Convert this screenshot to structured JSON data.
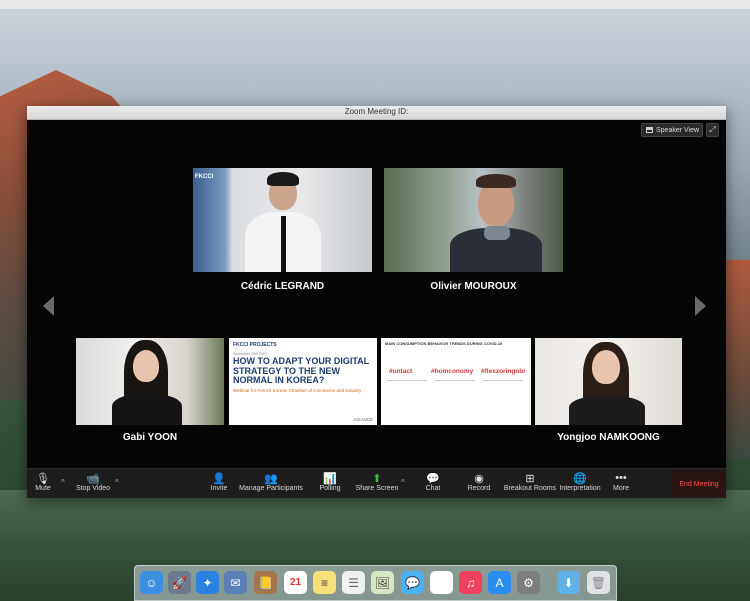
{
  "window": {
    "title": "Zoom Meeting ID:"
  },
  "view_controls": {
    "speaker_view_label": "Speaker View"
  },
  "participants": {
    "cedric": "Cédric LEGRAND",
    "olivier": "Olivier MOUROUX",
    "gabi": "Gabi YOON",
    "yongjoo": "Yongjoo NAMKOONG"
  },
  "slide1": {
    "logo": "FKCCI PROJECTS",
    "date": "September 28th 2020",
    "title": "HOW TO ADAPT YOUR DIGITAL STRATEGY TO THE NEW NORMAL IN KOREA?",
    "subtitle": "Webinar for French Korean Chamber of Commerce and Industry",
    "footer": "ASIANCE"
  },
  "slide2": {
    "title": "MAIN CONSUMPTION BEHAVIOR TRENDS DURING COVID-19",
    "tags": [
      "#untact",
      "#homconomy",
      "#flexzoringobi"
    ]
  },
  "toolbar": {
    "mute": "Mute",
    "stop_video": "Stop Video",
    "invite": "Invite",
    "manage_participants": "Manage Participants",
    "polling": "Polling",
    "share_screen": "Share Screen",
    "chat": "Chat",
    "record": "Record",
    "breakout_rooms": "Breakout Rooms",
    "interpretation": "Interpretation",
    "more": "More",
    "end_meeting": "End Meeting"
  },
  "colors": {
    "share_screen_green": "#2fbf4a",
    "end_meeting_red": "#ff4b4b",
    "slide_blue": "#1e3c72",
    "slide_accent": "#d93a3a"
  },
  "dock": {
    "icons": [
      "finder-icon",
      "launchpad-icon",
      "safari-icon",
      "mail-icon",
      "contacts-icon",
      "calendar-icon",
      "notes-icon",
      "reminders-icon",
      "photos-preview-icon",
      "messages-icon",
      "photos-icon",
      "music-icon",
      "app-store-icon",
      "system-preferences-icon",
      "downloads-icon",
      "trash-icon"
    ],
    "calendar_day": "21"
  }
}
